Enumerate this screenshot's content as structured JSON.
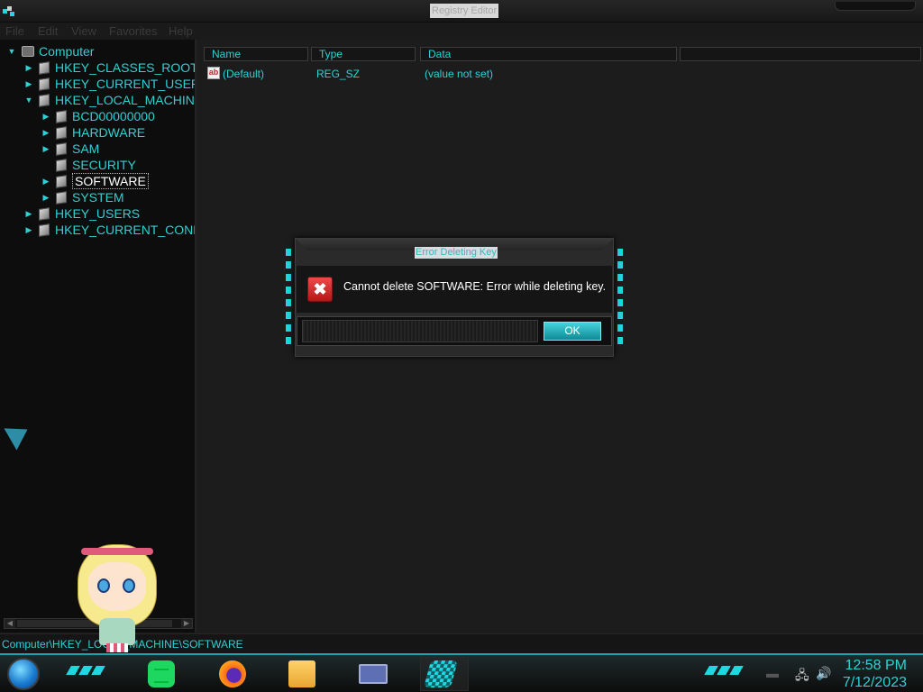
{
  "window": {
    "title": "Registry Editor"
  },
  "menu": [
    "File",
    "Edit",
    "View",
    "Favorites",
    "Help"
  ],
  "tree": {
    "root": "Computer",
    "items": [
      {
        "label": "HKEY_CLASSES_ROOT",
        "level": 1
      },
      {
        "label": "HKEY_CURRENT_USER",
        "level": 1
      },
      {
        "label": "HKEY_LOCAL_MACHINE",
        "level": 1
      },
      {
        "label": "BCD00000000",
        "level": 2
      },
      {
        "label": "HARDWARE",
        "level": 2
      },
      {
        "label": "SAM",
        "level": 2
      },
      {
        "label": "SECURITY",
        "level": 2
      },
      {
        "label": "SOFTWARE",
        "level": 2,
        "selected": true
      },
      {
        "label": "SYSTEM",
        "level": 2
      },
      {
        "label": "HKEY_USERS",
        "level": 1
      },
      {
        "label": "HKEY_CURRENT_CONFI",
        "level": 1
      }
    ]
  },
  "list": {
    "columns": [
      "Name",
      "Type",
      "Data"
    ],
    "rows": [
      {
        "name": "(Default)",
        "type": "REG_SZ",
        "data": "(value not set)"
      }
    ]
  },
  "statusbar": {
    "path": "Computer\\HKEY_LOCAL_MACHINE\\SOFTWARE"
  },
  "dialog": {
    "title": "Error Deleting Key",
    "message": "Cannot delete SOFTWARE:  Error while deleting key.",
    "ok_label": "OK"
  },
  "taskbar": {
    "pinned": [
      "spotify-icon",
      "firefox-icon",
      "file-explorer-icon",
      "window-icon",
      "regedit-icon"
    ],
    "time": "12:58 PM",
    "date": "7/12/2023"
  },
  "colors": {
    "accent": "#2fd1d4",
    "background": "#1c1c1c",
    "error": "#d42424"
  }
}
